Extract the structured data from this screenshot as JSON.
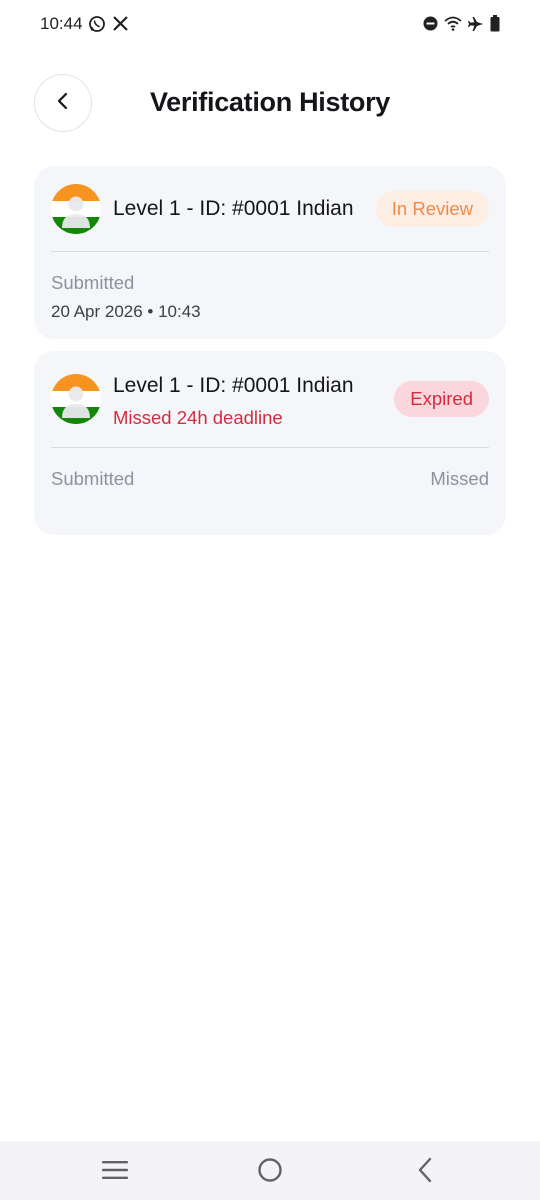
{
  "status_bar": {
    "time": "10:44",
    "left_icons": [
      "whatsapp-icon",
      "x-icon"
    ],
    "right_icons": [
      "do-not-disturb-icon",
      "wifi-icon",
      "airplane-mode-icon",
      "battery-icon"
    ]
  },
  "header": {
    "title": "Verification History",
    "back_icon": "chevron-left-icon"
  },
  "cards": [
    {
      "title": "Level 1 - ID: #0001 Indian",
      "badge": "In Review",
      "submitted_label": "Submitted",
      "submitted_value": "20 Apr 2026 • 10:43",
      "colors": {
        "badge_bg": "#fdeee4",
        "badge_text": "#f08a4b"
      }
    },
    {
      "title": "Level 1 - ID: #0001 Indian",
      "subtitle": "Missed 24h deadline",
      "badge": "Expired",
      "submitted_label": "Submitted",
      "submitted_value": "Missed",
      "colors": {
        "badge_bg": "#f9d7dd",
        "badge_text": "#d62b3f"
      }
    }
  ],
  "nav_bar": {
    "icons": [
      "menu-icon",
      "home-circle-icon",
      "back-chevron-icon"
    ]
  },
  "colors": {
    "card_bg": "#f5f6fa",
    "flag_saffron": "#f7931e",
    "flag_green": "#138808",
    "error": "#d62b3f"
  }
}
